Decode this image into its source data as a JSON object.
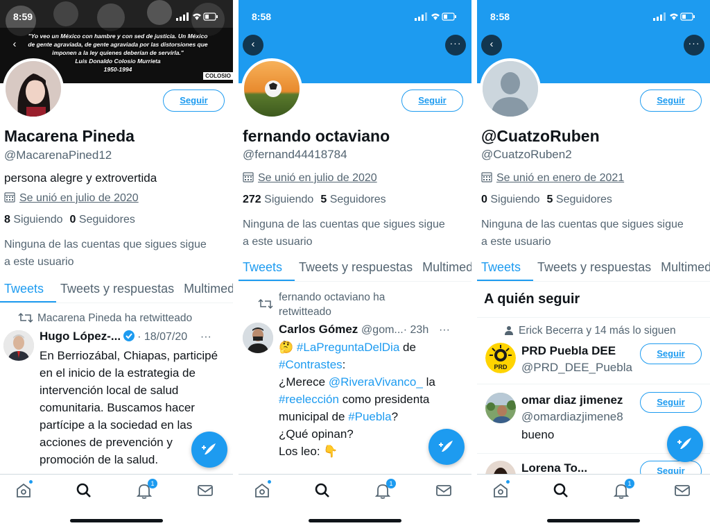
{
  "panels": [
    {
      "time": "8:59",
      "banner_quote": "\"Yo veo un México con hambre y con sed de justicia. Un México de gente agraviada, de gente agraviada por las distorsiones que imponen a la ley quienes deberían de servirla.\"",
      "banner_author": "Luis Donaldo Colosio Murrieta",
      "banner_years": "1950-1994",
      "banner_tag": "COLOSIO",
      "follow_label": "Seguir",
      "name": "Macarena Pineda",
      "handle": "@MacarenaPined12",
      "bio": "persona alegre y extrovertida",
      "joined": "Se unió en julio de 2020",
      "following_count": "8",
      "following_label": "Siguiendo",
      "followers_count": "0",
      "followers_label": "Seguidores",
      "mutual_text": "Ninguna de las cuentas que sigues sigue a este usuario",
      "tabs": [
        "Tweets",
        "Tweets y respuestas",
        "Multimedia"
      ],
      "retweet_line": "Macarena Pineda ha retwitteado",
      "tweet_author": "Hugo López-...",
      "tweet_meta": "· 18/07/20",
      "tweet_text": "En Berriozábal, Chiapas, participé en el inicio de la estrategia de intervención local de salud comunitaria. Buscamos hacer partícipe a la sociedad en las acciones de prevención y promoción de la salud."
    },
    {
      "time": "8:58",
      "follow_label": "Seguir",
      "name": "fernando octaviano",
      "handle": "@fernand44418784",
      "joined": "Se unió en julio de 2020",
      "following_count": "272",
      "following_label": "Siguiendo",
      "followers_count": "5",
      "followers_label": "Seguidores",
      "mutual_text": "Ninguna de las cuentas que sigues sigue a este usuario",
      "tabs": [
        "Tweets",
        "Tweets y respuestas",
        "Multimedia"
      ],
      "retweet_line": "fernando octaviano ha retwitteado",
      "tweet_author": "Carlos Gómez",
      "tweet_handle": "@gom...",
      "tweet_meta": "· 23h",
      "tweet_emoji": "🤔",
      "tweet_hashtag1": "#LaPreguntaDelDia",
      "tweet_de": "de",
      "tweet_hashtag2": "#Contrastes",
      "tweet_colon": ":",
      "tweet_q1": "¿Merece",
      "tweet_mention": "@RiveraVivanco_",
      "tweet_la": "la",
      "tweet_hashtag3": "#reelección",
      "tweet_como": "como presidenta",
      "tweet_municipal": "municipal de",
      "tweet_hashtag4": "#Puebla",
      "tweet_qmark": "?",
      "tweet_opinan": "¿Qué opinan?",
      "tweet_leo": "Los leo:",
      "tweet_leo_emoji": "👇"
    },
    {
      "time": "8:58",
      "follow_label": "Seguir",
      "name": "@CuatzoRuben",
      "handle": "@CuatzoRuben2",
      "joined": "Se unió en enero de 2021",
      "following_count": "0",
      "following_label": "Siguiendo",
      "followers_count": "5",
      "followers_label": "Seguidores",
      "mutual_text": "Ninguna de las cuentas que sigues sigue a este usuario",
      "tabs": [
        "Tweets",
        "Tweets y respuestas",
        "Multimedia"
      ],
      "who_title": "A quién seguir",
      "social_context": "Erick Becerra y 14 más lo siguen",
      "suggestions": [
        {
          "name": "PRD Puebla DEE",
          "handle": "@PRD_DEE_Puebla",
          "bio": "",
          "button": "Seguir",
          "avatar_text": "PRD"
        },
        {
          "name": "omar diaz jimenez",
          "handle": "@omardiazjimene8",
          "bio": "bueno",
          "button": "Seguir"
        },
        {
          "name": "Lorena To...",
          "handle": "",
          "bio": "",
          "button": "Seguir"
        }
      ]
    }
  ],
  "bottom_nav": {
    "items": [
      "home-icon",
      "search-icon",
      "notifications-icon",
      "messages-icon"
    ],
    "notification_badge": "1"
  },
  "colors": {
    "accent": "#1d9bf0",
    "text": "#0f1419",
    "secondary": "#536471"
  }
}
